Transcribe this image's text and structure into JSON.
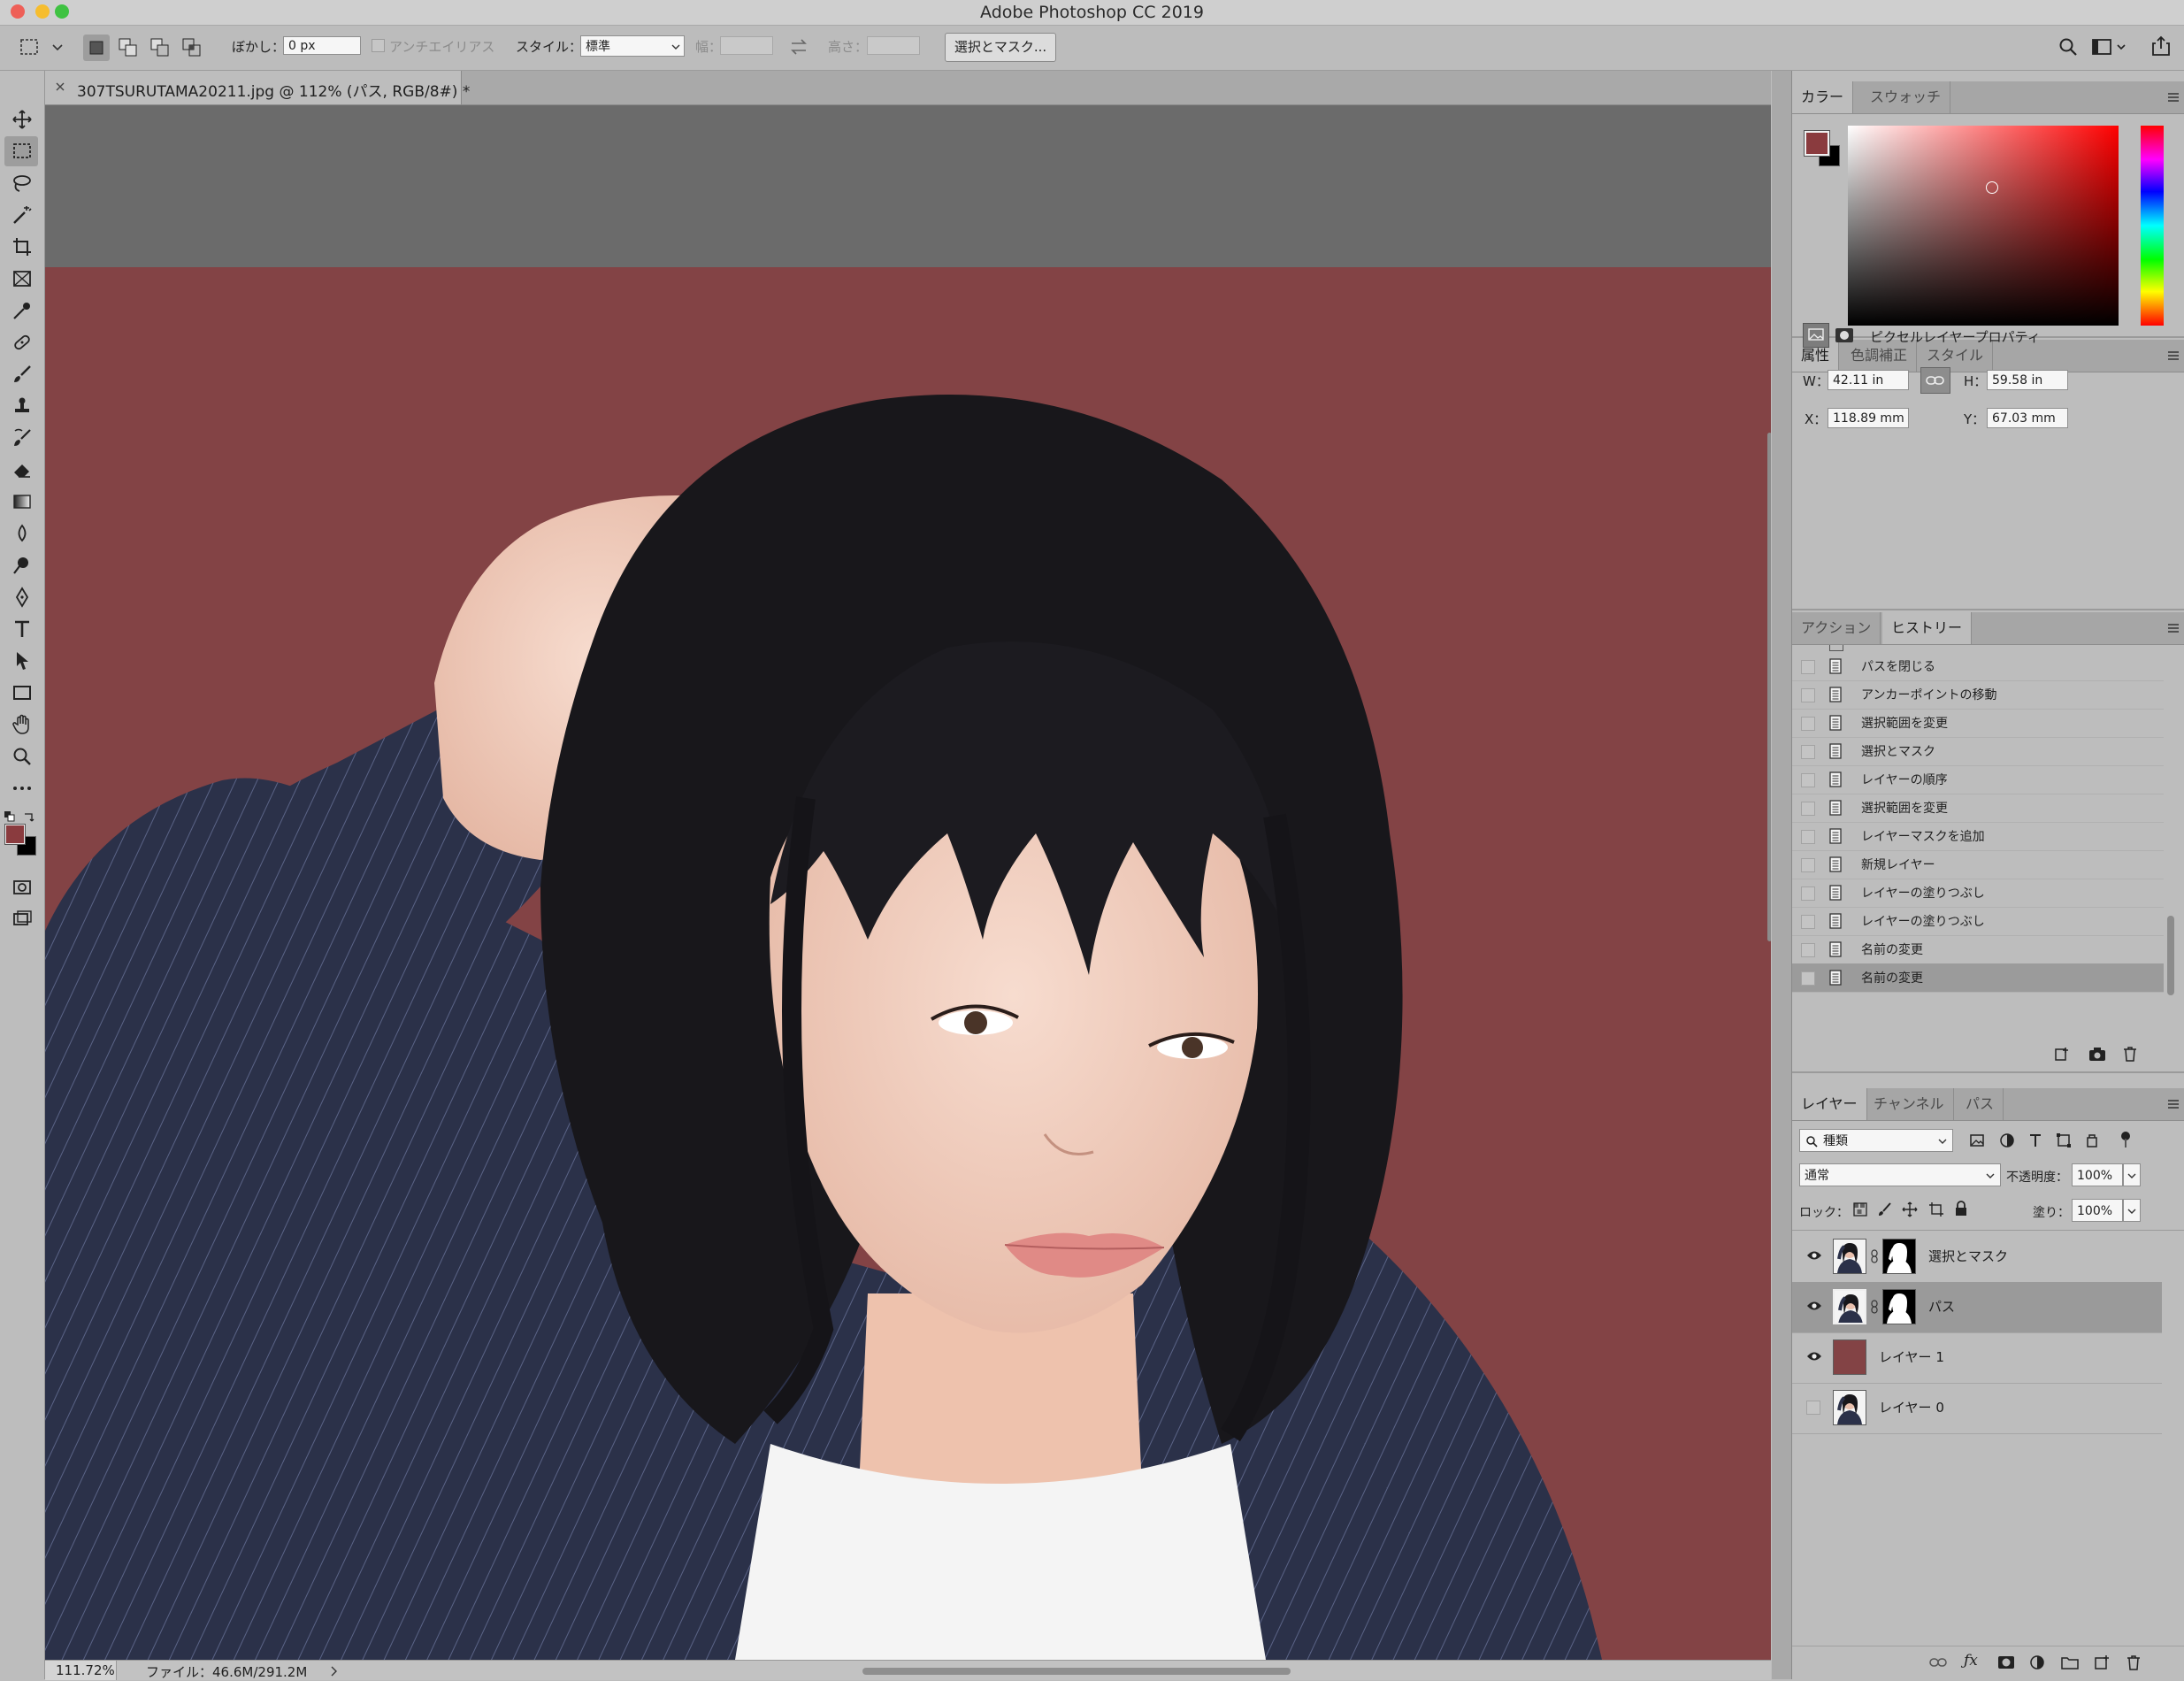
{
  "window": {
    "title": "Adobe Photoshop CC 2019"
  },
  "options_bar": {
    "feather_label": "ぼかし：",
    "feather_value": "0 px",
    "antialias_label": "アンチエイリアス",
    "style_label": "スタイル：",
    "style_value": "標準",
    "width_label": "幅：",
    "height_label": "高さ：",
    "select_mask_button": "選択とマスク..."
  },
  "document": {
    "tab_title": "307TSURUTAMA20211.jpg @ 112% (パス, RGB/8#) *",
    "canvas_background": "#834345",
    "zoom": "111.72%",
    "file_info": "ファイル：46.6M/291.2M"
  },
  "color_panel": {
    "tabs": [
      "カラー",
      "スウォッチ"
    ],
    "foreground": "#8a3b3e",
    "background": "#000000"
  },
  "properties_panel": {
    "tabs": [
      "属性",
      "色調補正",
      "スタイル"
    ],
    "title": "ピクセルレイヤープロパティ",
    "w_label": "W：",
    "w_value": "42.11 in",
    "h_label": "H：",
    "h_value": "59.58 in",
    "x_label": "X：",
    "x_value": "118.89 mm",
    "y_label": "Y：",
    "y_value": "67.03 mm"
  },
  "history_panel": {
    "tabs": [
      "アクション",
      "ヒストリー"
    ],
    "items": [
      "パスを閉じる",
      "アンカーポイントの移動",
      "選択範囲を変更",
      "選択とマスク",
      "レイヤーの順序",
      "選択範囲を変更",
      "レイヤーマスクを追加",
      "新規レイヤー",
      "レイヤーの塗りつぶし",
      "レイヤーの塗りつぶし",
      "名前の変更",
      "名前の変更"
    ]
  },
  "layers_panel": {
    "tabs": [
      "レイヤー",
      "チャンネル",
      "パス"
    ],
    "filter_value": "種類",
    "blend_mode": "通常",
    "opacity_label": "不透明度：",
    "opacity_value": "100%",
    "lock_label": "ロック：",
    "fill_label": "塗り：",
    "fill_value": "100%",
    "layers": [
      {
        "name": "選択とマスク",
        "visible": true
      },
      {
        "name": "パス",
        "visible": true
      },
      {
        "name": "レイヤー 1",
        "visible": true
      },
      {
        "name": "レイヤー 0",
        "visible": false
      }
    ]
  }
}
